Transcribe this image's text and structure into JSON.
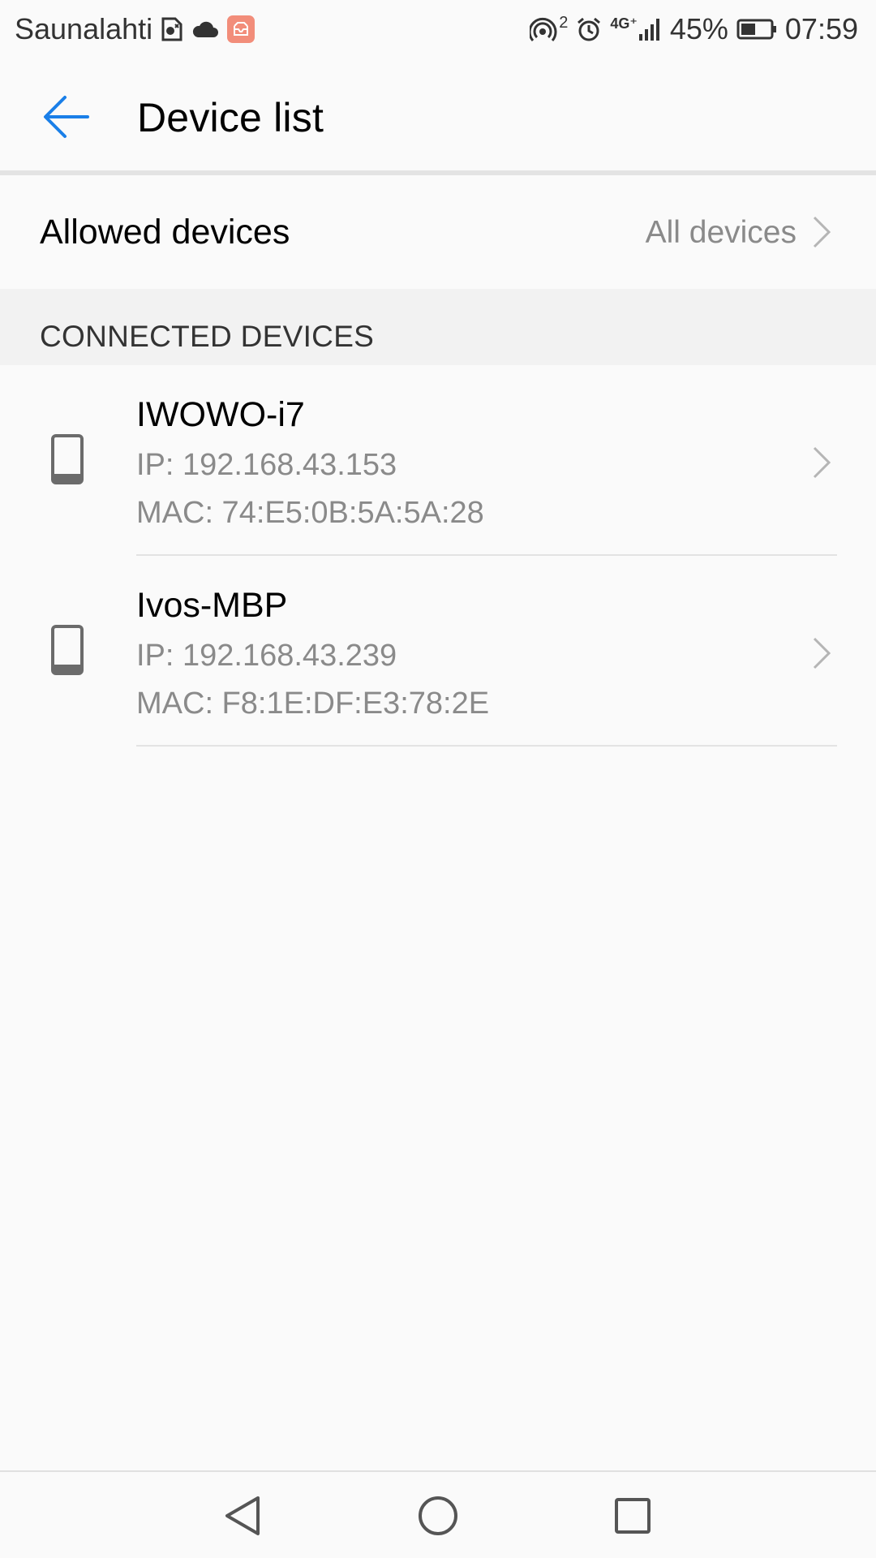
{
  "status_bar": {
    "carrier": "Saunalahti",
    "network_label": "4G⁺",
    "hotspot_count": "2",
    "battery": "45%",
    "time": "07:59",
    "icons": [
      "sim-card-icon",
      "cloud-icon",
      "notification-app-icon",
      "hotspot-icon",
      "alarm-icon",
      "signal-icon",
      "battery-icon"
    ]
  },
  "app_bar": {
    "back_icon": "arrow-left-icon",
    "title": "Device list"
  },
  "allowed": {
    "label": "Allowed devices",
    "value": "All devices"
  },
  "connected": {
    "header": "CONNECTED DEVICES",
    "devices": [
      {
        "name": "IWOWO-i7",
        "ip": "IP: 192.168.43.153",
        "mac": "MAC: 74:E5:0B:5A:5A:28"
      },
      {
        "name": "Ivos-MBP",
        "ip": "IP: 192.168.43.239",
        "mac": "MAC: F8:1E:DF:E3:78:2E"
      }
    ]
  },
  "nav_bar": {
    "icons": [
      "nav-back-icon",
      "nav-home-icon",
      "nav-recents-icon"
    ]
  },
  "colors": {
    "accent": "#1a7fe8",
    "background": "#fafafa",
    "section_bg": "#f2f2f2",
    "secondary_text": "#8a8a8a"
  }
}
